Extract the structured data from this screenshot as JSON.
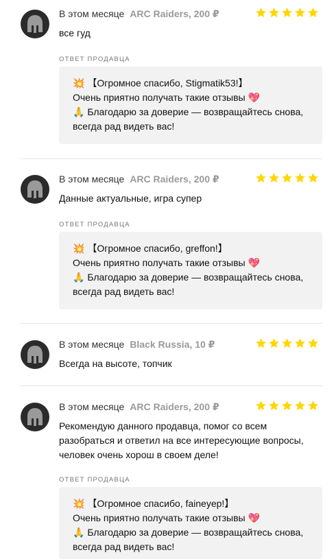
{
  "reviews": [
    {
      "date": "В этом месяце",
      "product": "ARC Raiders, 200 ₽",
      "rating": 5,
      "text": "все гуд",
      "reply_label": "ОТВЕТ ПРОДАВЦА",
      "reply_lines": [
        "💥 【Огромное спасибо, Stigmatik53!】",
        "Очень приятно получать такие отзывы 💖",
        "🙏 Благодарю за доверие — возвращайтесь снова, всегда рад видеть вас!"
      ]
    },
    {
      "date": "В этом месяце",
      "product": "ARC Raiders, 200 ₽",
      "rating": 5,
      "text": "Данные актуальные, игра супер",
      "reply_label": "ОТВЕТ ПРОДАВЦА",
      "reply_lines": [
        "💥 【Огромное спасибо, greffon!】",
        "Очень приятно получать такие отзывы 💖",
        "🙏 Благодарю за доверие — возвращайтесь снова, всегда рад видеть вас!"
      ]
    },
    {
      "date": "В этом месяце",
      "product": "Black Russia, 10 ₽",
      "rating": 5,
      "text": "Всегда на высоте, топчик"
    },
    {
      "date": "В этом месяце",
      "product": "ARC Raiders, 200 ₽",
      "rating": 5,
      "text": "Рекомендую данного продавца, помог со всем разобраться и ответил на все интересующие вопросы, человек очень хорош в своем деле!",
      "reply_label": "ОТВЕТ ПРОДАВЦА",
      "reply_lines": [
        "💥 【Огромное спасибо, faineyep!】",
        "Очень приятно получать такие отзывы 💖",
        "🙏 Благодарю за доверие — возвращайтесь снова, всегда рад видеть вас!"
      ]
    }
  ],
  "colors": {
    "star": "#ffd600",
    "avatar_bg": "#2b2b2b",
    "reply_bg": "#f2f2f2"
  },
  "icons": {
    "avatar": "spartan-helmet-icon",
    "star": "star-icon"
  }
}
